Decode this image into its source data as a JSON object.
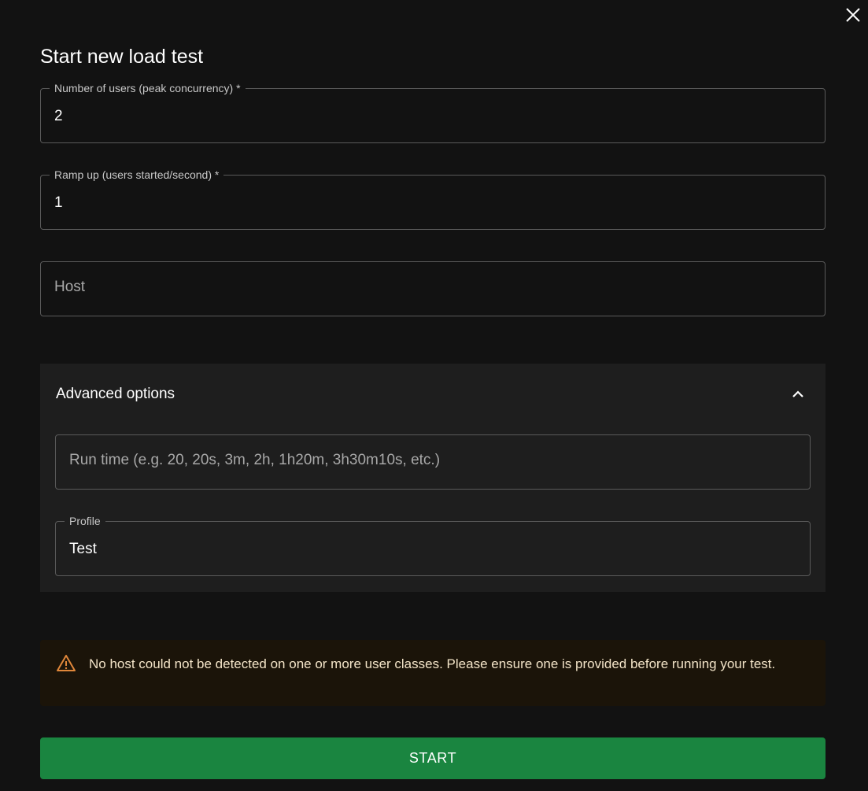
{
  "dialog": {
    "title": "Start new load test"
  },
  "fields": {
    "users": {
      "label": "Number of users (peak concurrency)",
      "required_mark": "*",
      "value": "2"
    },
    "ramp_up": {
      "label": "Ramp up (users started/second)",
      "required_mark": "*",
      "value": "1"
    },
    "host": {
      "placeholder": "Host"
    }
  },
  "advanced": {
    "label": "Advanced options",
    "expanded": true,
    "run_time": {
      "placeholder": "Run time (e.g. 20, 20s, 3m, 2h, 1h20m, 3h30m10s, etc.)"
    },
    "profile": {
      "label": "Profile",
      "value": "Test"
    }
  },
  "alert": {
    "severity": "warning",
    "message": "No host could not be detected on one or more user classes. Please ensure one is provided before running your test."
  },
  "actions": {
    "start_label": "START"
  },
  "icons": {
    "close": "close-icon",
    "expand": "chevron-up-icon",
    "warning": "warning-triangle-icon"
  },
  "colors": {
    "background": "#121212",
    "panel": "#1e1e1e",
    "primary": "#1a8540",
    "warning": "#e0873a",
    "alert_background": "#1b1409"
  }
}
